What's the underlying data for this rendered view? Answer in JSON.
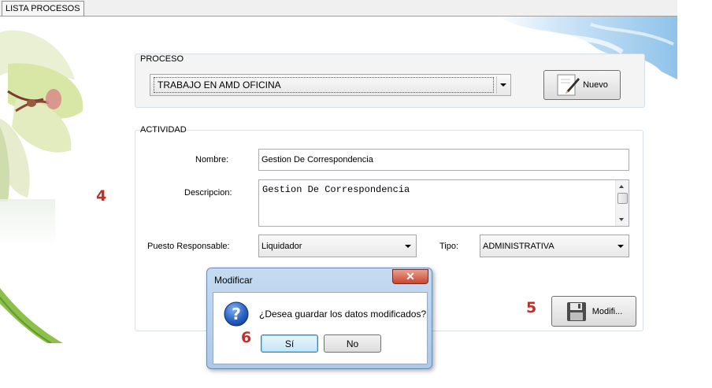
{
  "tab": {
    "label": "LISTA PROCESOS"
  },
  "proceso": {
    "group_label": "PROCESO",
    "selected": "TRABAJO EN AMD OFICINA",
    "new_button_label": "Nuevo"
  },
  "actividad": {
    "group_label": "ACTIVIDAD",
    "nombre_label": "Nombre:",
    "nombre_value": "Gestion De Correspondencia",
    "descripcion_label": "Descripcion:",
    "descripcion_value": "Gestion De Correspondencia",
    "puesto_label": "Puesto Responsable:",
    "puesto_value": "Liquidador",
    "tipo_label": "Tipo:",
    "tipo_value": "ADMINISTRATIVA",
    "modify_button_label": "Modifi..."
  },
  "annotations": {
    "a4": "4",
    "a5": "5",
    "a6": "6"
  },
  "dialog": {
    "title": "Modificar",
    "message": "¿Desea guardar los datos modificados?",
    "yes_label": "Sí",
    "no_label": "No",
    "close_symbol": "✕"
  },
  "colors": {
    "annotation": "#c0302b",
    "dialog_frame": "#adc8e6",
    "close_button": "#c9452f"
  }
}
